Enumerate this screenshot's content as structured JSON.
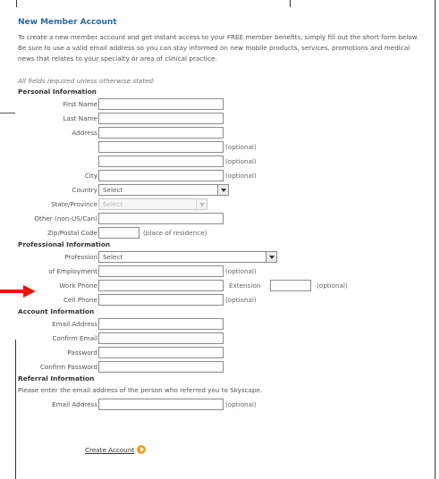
{
  "title": "New Member Account",
  "intro": "To create a new member account and get instant access to your FREE member benefits, simply fill out the short form below. Be sure to use a valid email address so you can stay informed on new mobile products, services, promotions and medical news that relates to your specialty or area of clinical practice.",
  "required_note": "All fields required unless otherwise stated:",
  "personal": {
    "heading": "Personal Information",
    "first_name": "First Name",
    "last_name": "Last Name",
    "address": "Address",
    "address2_note": "(optional)",
    "address3_note": "(optional)",
    "city": "City",
    "city_note": "(optional)",
    "country": "Country",
    "country_value": "Select",
    "state": "State/Province",
    "state_value": "Select",
    "other": "Other (non-US/Can)",
    "zip": "Zip/Postal Code",
    "zip_note": "(place of residence)"
  },
  "professional": {
    "heading": "Professional Information",
    "profession": "Profession",
    "profession_value": "Select",
    "employment": "of Employment",
    "employment_note": "(optional)",
    "work_phone": "Work Phone",
    "extension": "Extension",
    "extension_note": "(optional)",
    "cell_phone": "Cell Phone",
    "cell_note": "(optional)"
  },
  "account": {
    "heading": "Account Information",
    "email": "Email Address",
    "confirm_email": "Confirm Email",
    "password": "Password",
    "confirm_password": "Confirm Password"
  },
  "referral": {
    "heading": "Referral Information",
    "text": "Please enter the email address of the person who referred you to Skyscape.",
    "email": "Email Address",
    "email_note": "(optional)"
  },
  "create_label": "Create Account",
  "colors": {
    "title": "#2a6aa6",
    "arrow": "#e8140c",
    "go_button": "#f0a020"
  }
}
